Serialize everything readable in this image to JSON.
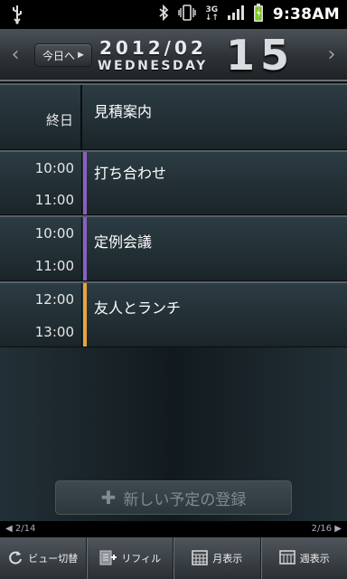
{
  "status_bar": {
    "time": "9:38AM",
    "network": "3G"
  },
  "header": {
    "today_label": "今日へ",
    "year_month": "2012/02",
    "weekday": "WEDNESDAY",
    "day": "15"
  },
  "events": [
    {
      "start": "終日",
      "end": "",
      "title": "見積案内",
      "color": ""
    },
    {
      "start": "10:00",
      "end": "11:00",
      "title": "打ち合わせ",
      "color": "#8a5fc0"
    },
    {
      "start": "10:00",
      "end": "11:00",
      "title": "定例会議",
      "color": "#8a5fc0"
    },
    {
      "start": "12:00",
      "end": "13:00",
      "title": "友人とランチ",
      "color": "#e8a43a"
    }
  ],
  "add_button": {
    "label": "新しい予定の登録"
  },
  "pager": {
    "prev": "2/14",
    "next": "2/16"
  },
  "toolbar": {
    "view_switch": "ビュー切替",
    "refill": "リフィル",
    "month": "月表示",
    "week": "週表示"
  }
}
